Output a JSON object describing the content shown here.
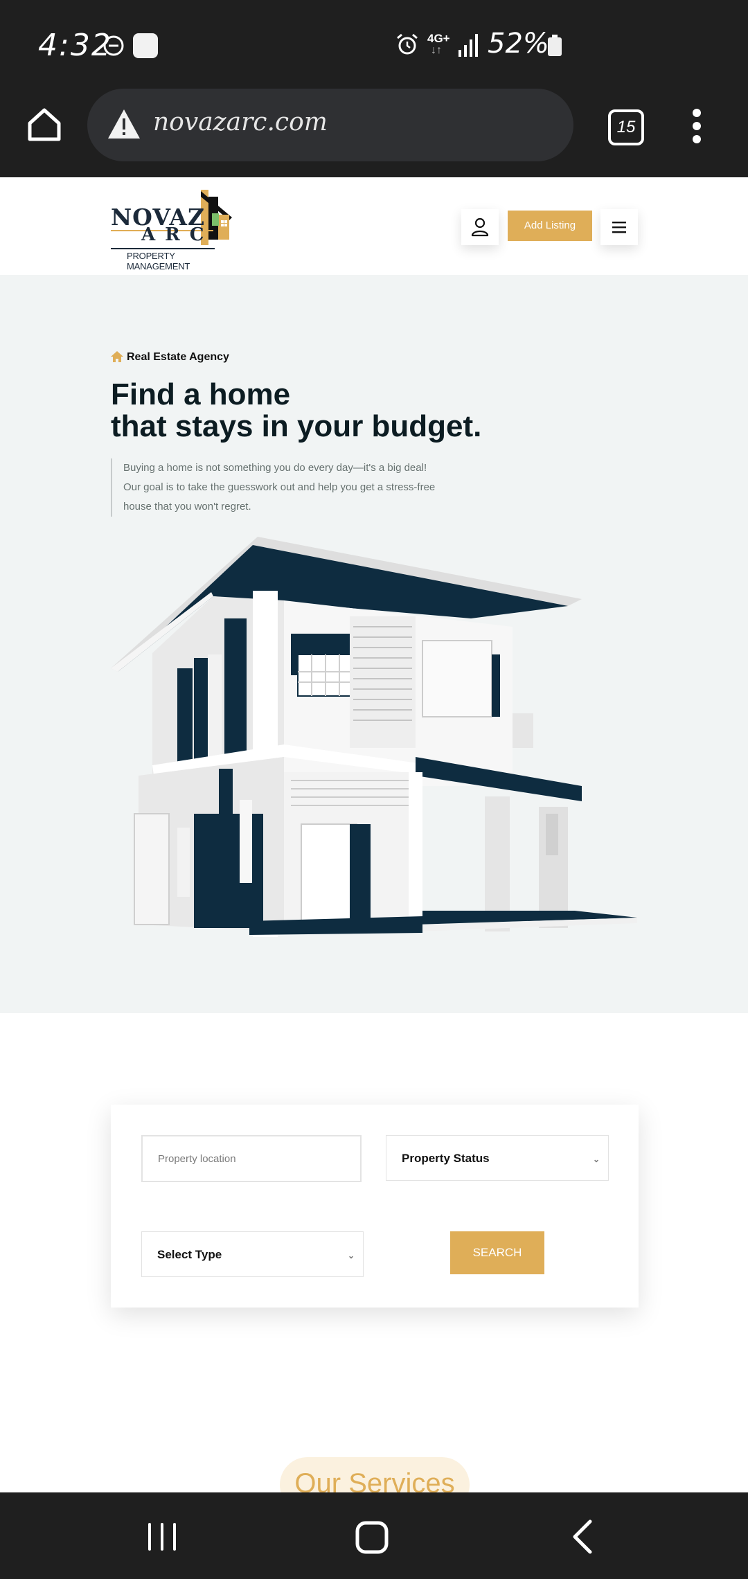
{
  "status_bar": {
    "time": "4:32",
    "network": "4G+",
    "network_arrows": "↓↑",
    "battery": "52%"
  },
  "browser": {
    "url": "novazarc.com",
    "tab_count": "15"
  },
  "header": {
    "logo": {
      "line1": "NOVAZ",
      "line2": "ARC",
      "tagline": "PROPERTY MANAGEMENT"
    },
    "add_listing_label": "Add Listing"
  },
  "hero": {
    "tag": "Real Estate Agency",
    "title_line1": "Find a home",
    "title_line2": "that stays in your budget.",
    "desc_line1": "Buying a home is not something you do every day—it's a big deal!",
    "desc_line2": "Our goal is to take the guesswork out and help you get a stress-free",
    "desc_line3": "house that you won't regret."
  },
  "search": {
    "location_placeholder": "Property location",
    "status_value": "Property Status",
    "type_value": "Select Type",
    "search_label": "SEARCH"
  },
  "services": {
    "title": "Our Services"
  },
  "colors": {
    "accent": "#dfae58",
    "dark": "#0c1c22",
    "house_dark": "#0e2c40",
    "hero_bg": "#f1f4f4",
    "system_bar": "#1f1f1f"
  }
}
